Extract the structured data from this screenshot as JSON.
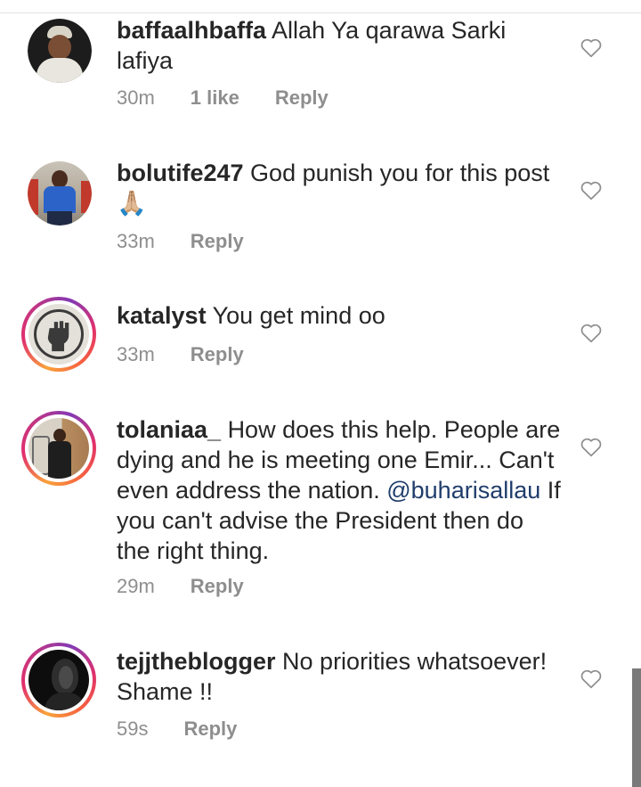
{
  "comments": [
    {
      "username": "baffaalhbaffa",
      "text": "Allah Ya qarawa Sarki lafiya",
      "time": "30m",
      "likes": "1 like",
      "reply": "Reply",
      "avatar_style": "plain"
    },
    {
      "username": "bolutife247",
      "text": "God punish you for this post",
      "emoji": "🙏🏼",
      "time": "33m",
      "reply": "Reply",
      "avatar_style": "plain"
    },
    {
      "username": "katalyst",
      "text": "You get mind oo",
      "time": "33m",
      "reply": "Reply",
      "avatar_style": "story-ring"
    },
    {
      "username": "tolaniaa_",
      "text": "How does this help. People are dying and he is meeting one Emir... Can't even address the nation.",
      "mention": "@buharisallau",
      "text_after": "If you can't advise the President then do the right thing.",
      "time": "29m",
      "reply": "Reply",
      "avatar_style": "story-ring"
    },
    {
      "username": "tejjtheblogger",
      "text": "No priorities whatsoever! Shame !!",
      "time": "59s",
      "reply": "Reply",
      "avatar_style": "story-ring"
    }
  ],
  "icons": {
    "like": "heart-outline-icon"
  },
  "colors": {
    "story_ring_start": "#f9a23a",
    "story_ring_end": "#833ab4",
    "mention": "#1f3d6b",
    "meta": "#8e8e8e"
  }
}
